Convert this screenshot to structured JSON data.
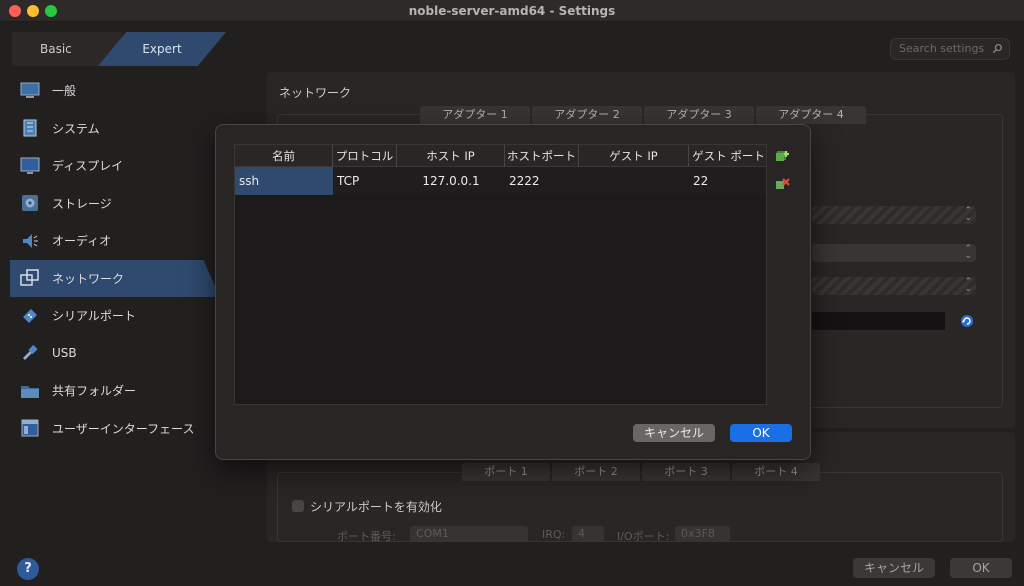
{
  "window": {
    "title": "noble-server-amd64 - Settings"
  },
  "mode_tabs": {
    "basic": "Basic",
    "expert": "Expert"
  },
  "search": {
    "placeholder": "Search settings"
  },
  "sidebar": {
    "items": [
      {
        "label": "一般",
        "icon": "monitor-icon"
      },
      {
        "label": "システム",
        "icon": "chip-icon"
      },
      {
        "label": "ディスプレイ",
        "icon": "display-icon"
      },
      {
        "label": "ストレージ",
        "icon": "disk-icon"
      },
      {
        "label": "オーディオ",
        "icon": "speaker-icon"
      },
      {
        "label": "ネットワーク",
        "icon": "network-icon",
        "active": true
      },
      {
        "label": "シリアルポート",
        "icon": "serial-icon"
      },
      {
        "label": "USB",
        "icon": "usb-icon"
      },
      {
        "label": "共有フォルダー",
        "icon": "folder-icon"
      },
      {
        "label": "ユーザーインターフェース",
        "icon": "window-icon"
      }
    ]
  },
  "network": {
    "title": "ネットワーク",
    "adapter_tabs": [
      "アダプター 1",
      "アダプター 2",
      "アダプター 3",
      "アダプター 4"
    ]
  },
  "serial": {
    "port_tabs": [
      "ポート 1",
      "ポート 2",
      "ポート 3",
      "ポート 4"
    ],
    "enable_label": "シリアルポートを有効化",
    "port_number_label": "ポート番号:",
    "port_value": "COM1",
    "irq_label": "IRQ:",
    "irq_value": "4",
    "io_port_label": "I/Oポート:",
    "io_port_value": "0x3F8"
  },
  "footer": {
    "help": "?",
    "cancel": "キャンセル",
    "ok": "OK"
  },
  "port_forwarding": {
    "columns": [
      "名前",
      "プロトコル",
      "ホスト IP",
      "ホストポート",
      "ゲスト IP",
      "ゲスト ポート"
    ],
    "rows": [
      {
        "name": "ssh",
        "protocol": "TCP",
        "host_ip": "127.0.0.1",
        "host_port": "2222",
        "guest_ip": "",
        "guest_port": "22"
      }
    ],
    "cancel": "キャンセル",
    "ok": "OK"
  },
  "colors": {
    "accent": "#2f4a6e",
    "ok_button": "#1a6ee6"
  }
}
